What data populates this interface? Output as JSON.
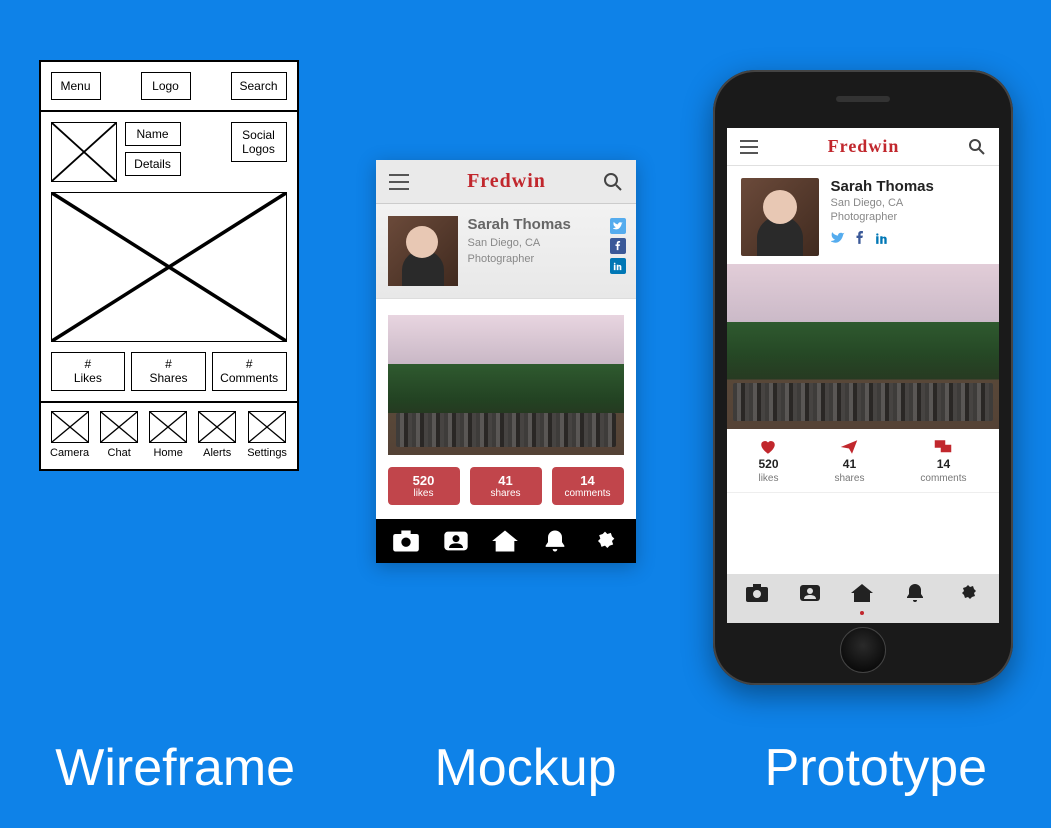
{
  "labels": {
    "wireframe": "Wireframe",
    "mockup": "Mockup",
    "prototype": "Prototype"
  },
  "brand": "Fredwin",
  "wire": {
    "header": {
      "menu": "Menu",
      "logo": "Logo",
      "search": "Search"
    },
    "profile": {
      "image": "",
      "name": "Name",
      "details": "Details",
      "social": "Social Logos"
    },
    "stats": {
      "likes_top": "#",
      "likes": "Likes",
      "shares_top": "#",
      "shares": "Shares",
      "comments_top": "#",
      "comments": "Comments"
    },
    "nav": [
      "Camera",
      "Chat",
      "Home",
      "Alerts",
      "Settings"
    ]
  },
  "user": {
    "name": "Sarah Thomas",
    "location": "San Diego, CA",
    "role": "Photographer"
  },
  "stats": {
    "likes": {
      "n": "520",
      "label": "likes"
    },
    "shares": {
      "n": "41",
      "label": "shares"
    },
    "comments": {
      "n": "14",
      "label": "comments"
    }
  },
  "colors": {
    "accent": "#c1272d",
    "bg": "#0e82e8"
  }
}
